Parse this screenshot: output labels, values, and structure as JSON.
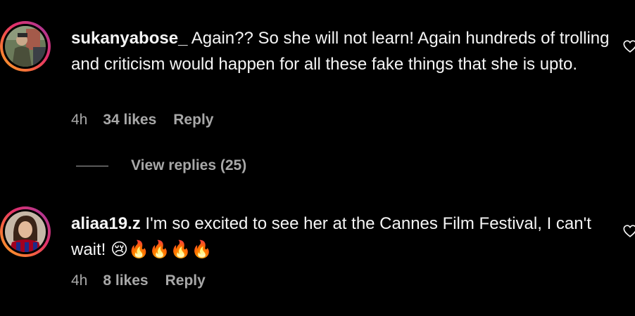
{
  "comments": [
    {
      "username": "sukanyabose_",
      "text": "Again?? So she will not learn! Again hundreds of trolling and criticism would happen for all these fake things that she is upto.",
      "time": "4h",
      "likes": "34 likes",
      "reply": "Reply",
      "view_replies": "View replies (25)"
    },
    {
      "username": "aliaa19.z",
      "text": "I'm so excited to see her at the Cannes Film Festival, I can't wait! 😢🔥🔥🔥🔥",
      "time": "4h",
      "likes": "8 likes",
      "reply": "Reply"
    }
  ],
  "colors": {
    "background": "#000000",
    "text": "#f5f5f5",
    "meta": "#a8a8a8",
    "ring_start": "#f9a825",
    "ring_end": "#833ab4"
  },
  "icons": {
    "like": "heart-outline-icon"
  }
}
